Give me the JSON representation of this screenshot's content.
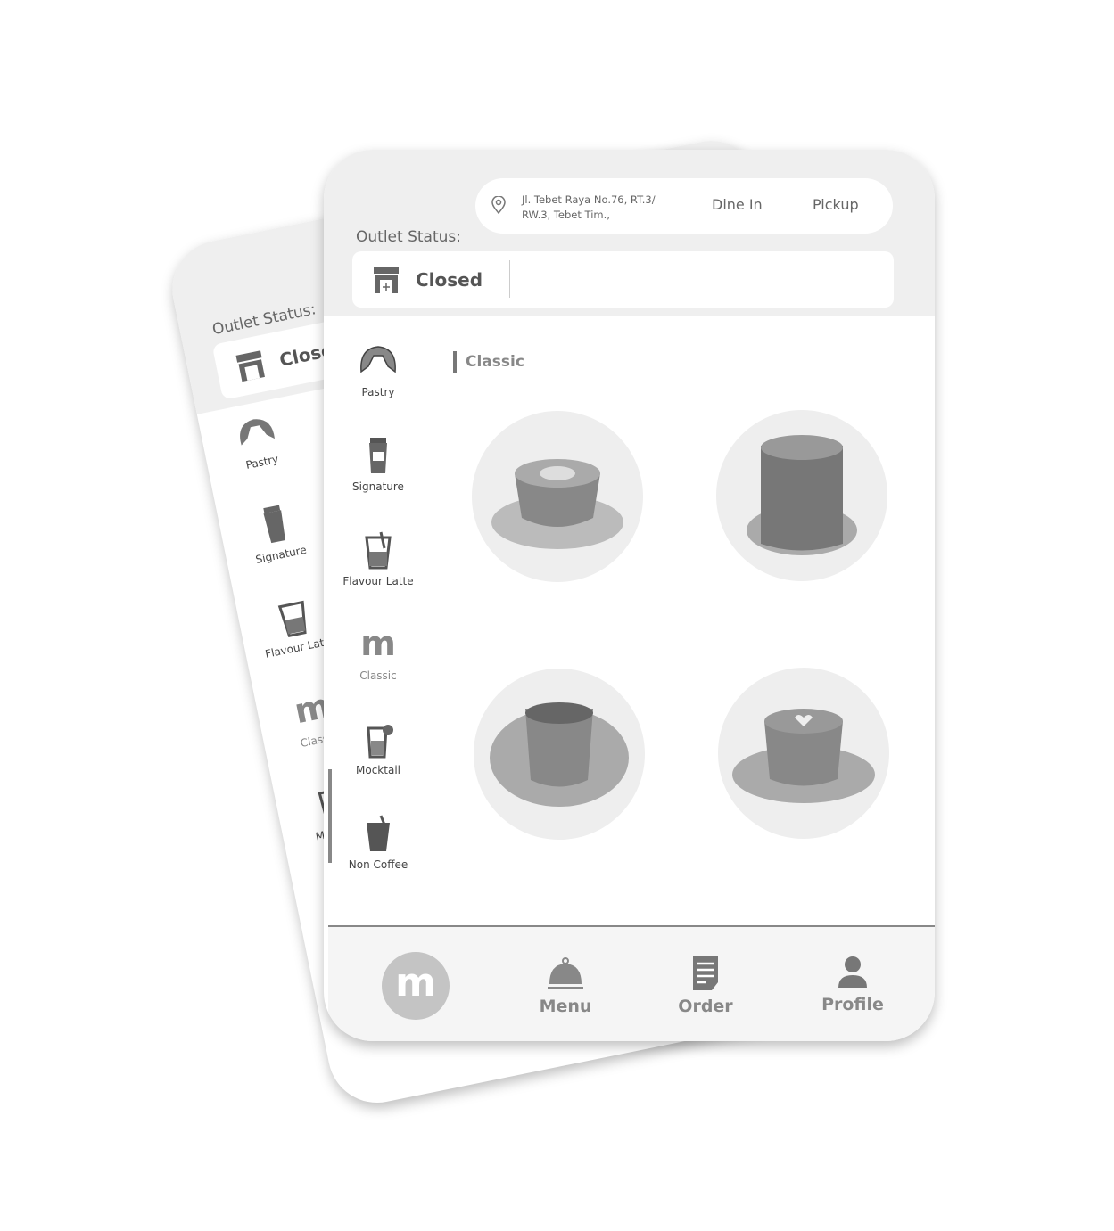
{
  "header": {
    "address_line1": "Jl. Tebet Raya No.76, RT.3/",
    "address_line2": "RW.3, Tebet Tim.,",
    "dine_in": "Dine In",
    "pickup": "Pickup",
    "outlet_status_label": "Outlet Status:",
    "outlet_status": "Closed"
  },
  "categories": [
    {
      "label": "Pastry",
      "icon": "croissant-icon"
    },
    {
      "label": "Signature",
      "icon": "cup-icon"
    },
    {
      "label": "Flavour Latte",
      "icon": "iced-latte-icon"
    },
    {
      "label": "Classic",
      "icon": "m-logo-icon",
      "active": true
    },
    {
      "label": "Mocktail",
      "icon": "mocktail-icon"
    },
    {
      "label": "Non Coffee",
      "icon": "iced-drink-icon"
    }
  ],
  "section_title": "Classic",
  "products": [
    {
      "image": "latte-art-cup"
    },
    {
      "image": "iced-coffee-glass"
    },
    {
      "image": "espresso-cup"
    },
    {
      "image": "heart-latte-cup"
    }
  ],
  "nav": {
    "logo": "m",
    "menu": "Menu",
    "order": "Order",
    "profile": "Profile"
  },
  "colors": {
    "header_bg": "#efefef",
    "nav_bg": "#f5f5f5",
    "logo_bg": "#c4c4c4"
  }
}
